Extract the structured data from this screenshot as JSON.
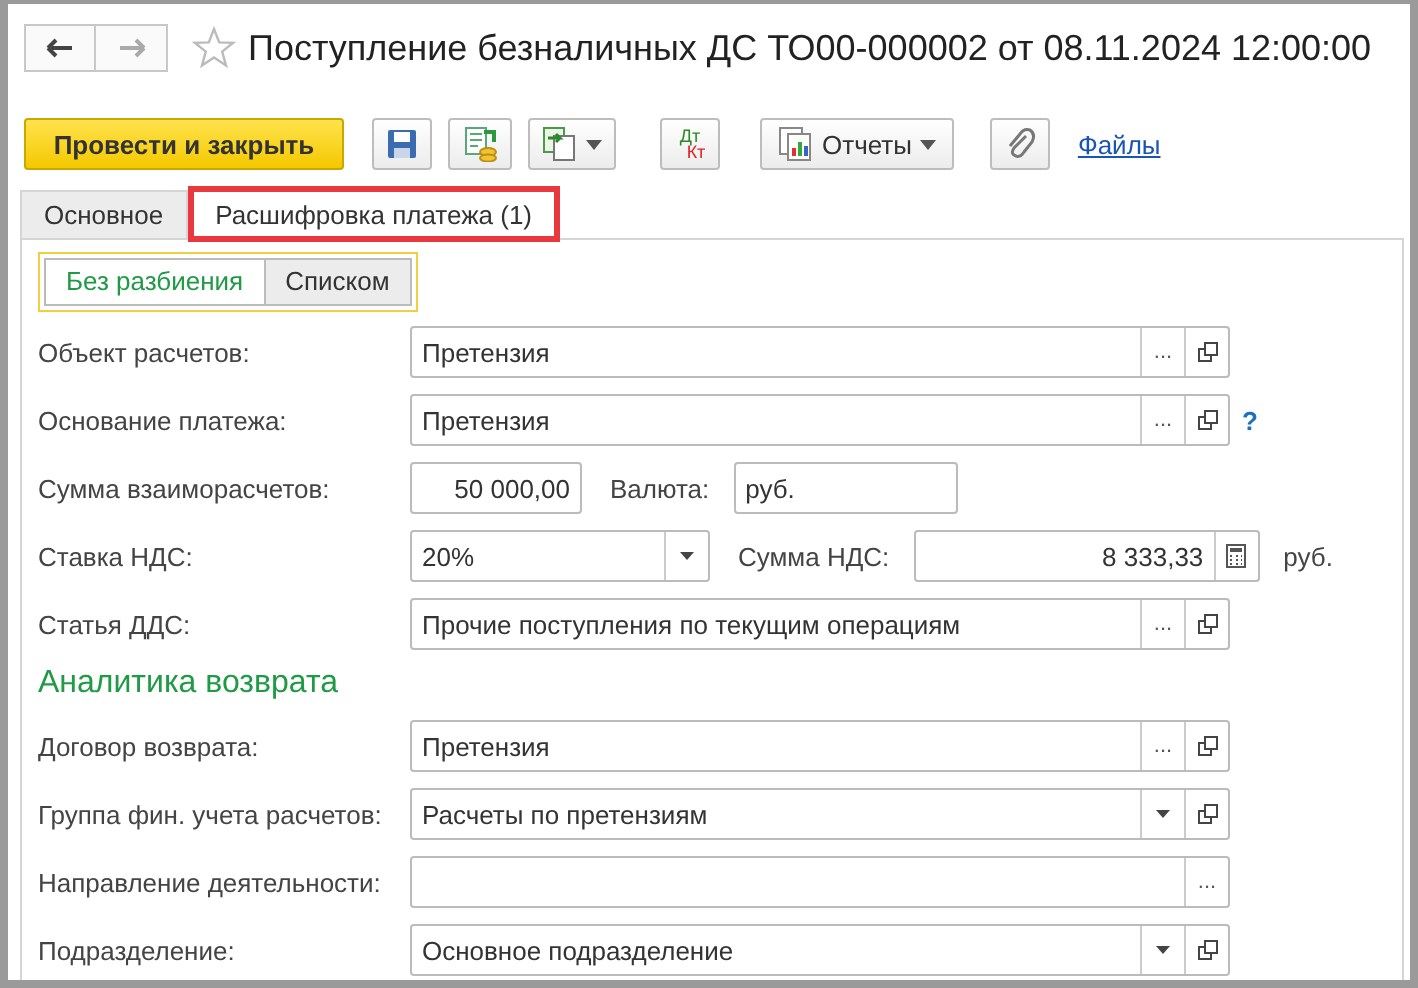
{
  "window": {
    "title": "Поступление безналичных ДС ТО00-000002 от 08.11.2024 12:00:00",
    "favorite": false
  },
  "toolbar": [
    {
      "kind": "primary",
      "label": "Провести и закрыть"
    },
    {
      "kind": "save"
    },
    {
      "kind": "post"
    },
    {
      "kind": "copy_menu"
    },
    {
      "kind": "dtkt",
      "debit": "Дт",
      "credit": "Кт"
    },
    {
      "kind": "reports",
      "label": "Отчеты"
    },
    {
      "kind": "attach"
    },
    {
      "kind": "link",
      "label": "Файлы"
    }
  ],
  "tabs": [
    {
      "label": "Основное",
      "selected": false,
      "highlighted": false
    },
    {
      "label": "Расшифровка платежа (1)",
      "selected": true,
      "highlighted": true
    }
  ],
  "split_mode": [
    {
      "label": "Без разбиения",
      "selected": true
    },
    {
      "label": "Списком",
      "selected": false
    }
  ],
  "rows": [
    {
      "label": "Объект расчетов:",
      "items": [
        {
          "kind": "ref_field",
          "value": "Претензия",
          "buttons": [
            {
              "kind": "choice",
              "text": "..."
            },
            {
              "kind": "open"
            }
          ]
        }
      ]
    },
    {
      "label": "Основание платежа:",
      "items": [
        {
          "kind": "ref_field",
          "value": "Претензия",
          "buttons": [
            {
              "kind": "choice",
              "text": "..."
            },
            {
              "kind": "open"
            }
          ]
        },
        {
          "kind": "help",
          "text": "?"
        }
      ]
    },
    {
      "label": "Сумма взаиморасчетов:",
      "items": [
        {
          "kind": "number_field",
          "value": "50 000,00"
        },
        {
          "kind": "caption",
          "text": "Валюта:"
        },
        {
          "kind": "text_field",
          "value": "руб."
        }
      ]
    },
    {
      "label": "Ставка НДС:",
      "items": [
        {
          "kind": "select_field",
          "value": "20%",
          "buttons": [
            {
              "kind": "dropdown"
            }
          ]
        },
        {
          "kind": "caption",
          "text": "Сумма НДС:"
        },
        {
          "kind": "calc_field",
          "value": "8 333,33",
          "buttons": [
            {
              "kind": "calc"
            }
          ]
        },
        {
          "kind": "suffix",
          "text": "руб."
        }
      ]
    },
    {
      "label": "Статья ДДС:",
      "items": [
        {
          "kind": "ref_field",
          "value": "Прочие поступления по текущим операциям",
          "buttons": [
            {
              "kind": "choice",
              "text": "..."
            },
            {
              "kind": "open"
            }
          ]
        }
      ]
    }
  ],
  "return_section": {
    "title": "Аналитика возврата",
    "rows": [
      {
        "label": "Договор возврата:",
        "items": [
          {
            "kind": "ref_field",
            "value": "Претензия",
            "buttons": [
              {
                "kind": "choice",
                "text": "..."
              },
              {
                "kind": "open"
              }
            ]
          }
        ]
      },
      {
        "label": "Группа фин. учета расчетов:",
        "items": [
          {
            "kind": "ref_field",
            "value": "Расчеты по претензиям",
            "buttons": [
              {
                "kind": "dropdown"
              },
              {
                "kind": "open"
              }
            ]
          }
        ]
      },
      {
        "label": "Направление деятельности:",
        "items": [
          {
            "kind": "ref_field",
            "buttons": [
              {
                "kind": "choice",
                "text": "..."
              }
            ]
          }
        ]
      },
      {
        "label": "Подразделение:",
        "items": [
          {
            "kind": "ref_field",
            "value": "Основное подразделение",
            "buttons": [
              {
                "kind": "dropdown"
              },
              {
                "kind": "open"
              }
            ]
          }
        ]
      }
    ]
  }
}
